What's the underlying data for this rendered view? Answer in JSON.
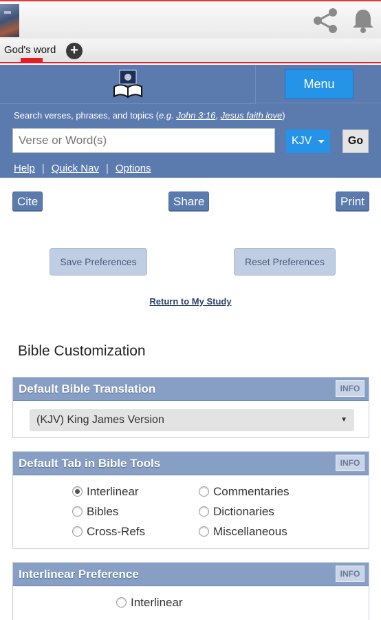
{
  "appbar": {
    "share_icon": "share-icon",
    "bell_icon": "bell-icon"
  },
  "tabs": {
    "active_tab": "God's word",
    "add_icon": "plus-icon",
    "add_symbol": "+"
  },
  "header": {
    "menu_label": "Menu",
    "hint_prefix": "Search verses, phrases, and topics (",
    "hint_eg": "e.g.",
    "hint_example1": "John 3:16",
    "hint_comma": ", ",
    "hint_example2": "Jesus faith love",
    "hint_suffix": ")",
    "search_placeholder": "Verse or Word(s)",
    "version": "KJV",
    "go_label": "Go",
    "nav": {
      "help": "Help",
      "quick_nav": "Quick Nav",
      "options": "Options",
      "sep": "|"
    }
  },
  "actions": {
    "cite": "Cite",
    "share": "Share",
    "print": "Print"
  },
  "preferences": {
    "save": "Save Preferences",
    "reset": "Reset Preferences",
    "return_link": "Return to My Study"
  },
  "section_title": "Bible Customization",
  "panels": {
    "default_translation": {
      "title": "Default Bible Translation",
      "info": "INFO",
      "selected": "(KJV) King James Version",
      "arrow": "▼"
    },
    "default_tab": {
      "title": "Default Tab in Bible Tools",
      "info": "INFO",
      "options": [
        "Interlinear",
        "Bibles",
        "Cross-Refs",
        "Commentaries",
        "Dictionaries",
        "Miscellaneous"
      ],
      "selected": "Interlinear"
    },
    "interlinear_pref": {
      "title": "Interlinear Preference",
      "info": "INFO",
      "options": [
        "Interlinear"
      ]
    }
  },
  "colors": {
    "header_blue": "#5b7bae",
    "menu_blue": "#2493e8",
    "panel_head": "#879ec5",
    "accent_red": "#e21d24"
  }
}
